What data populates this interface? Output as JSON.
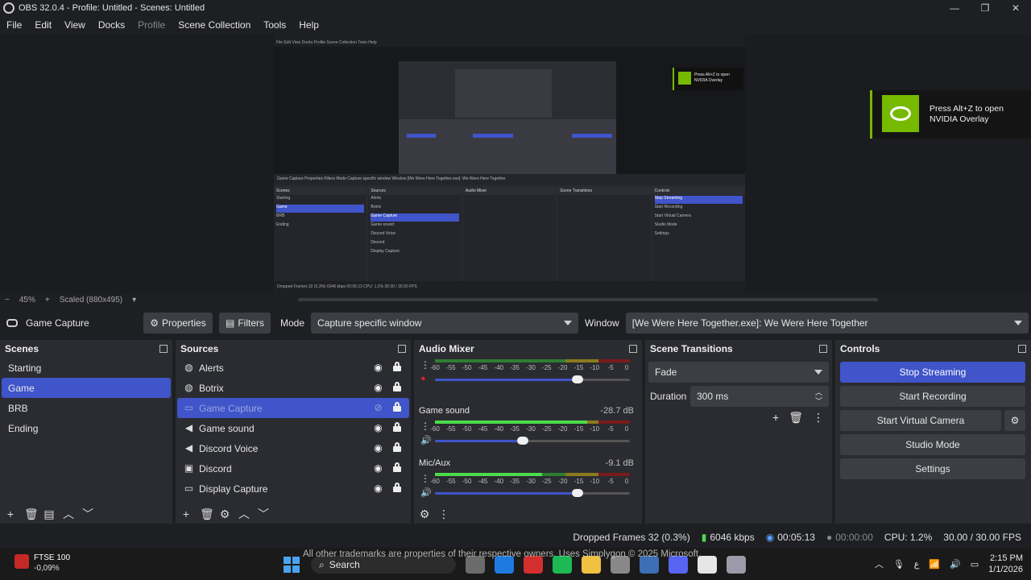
{
  "window": {
    "title": "OBS 32.0.4 - Profile: Untitled - Scenes: Untitled",
    "minimize": "—",
    "maximize": "❐",
    "close": "✕"
  },
  "menu": [
    "File",
    "Edit",
    "View",
    "Docks",
    "Profile",
    "Scene Collection",
    "Tools",
    "Help"
  ],
  "menu_disabled_index": 4,
  "nested_preview": {
    "menu_text": "File  Edit  View  Docks  Profile  Scene Collection  Tools  Help",
    "toolbar_text": "Game Capture    Properties    Filters    Mode   Capture specific window                         Window  [We Were Here Together.exe]: We Were Here Together",
    "scenes": [
      "Scenes",
      "Starting",
      "Game",
      "BRB",
      "Ending"
    ],
    "sources": [
      "Sources",
      "Alerts",
      "Botrix",
      "Game Capture",
      "Game sound",
      "Discord Voice",
      "Discord",
      "Display Capture"
    ],
    "mixer": "Audio Mixer",
    "transitions": "Scene Transitions",
    "controls": [
      "Controls",
      "Stop Streaming",
      "Start Recording",
      "Start Virtual Camera",
      "Studio Mode",
      "Settings"
    ],
    "toast": "Press Alt+Z to open NVIDIA Overlay",
    "status": "Dropped Frames 32 (0.3%)   6046 kbps   00:05:13   CPU: 1.2%   30.00 / 30.00 FPS"
  },
  "nvidia_toast": {
    "text": "Press Alt+Z to open NVIDIA Overlay",
    "accent": "#76b900"
  },
  "zoom": {
    "minus": "−",
    "percent": "45%",
    "plus": "+",
    "scaled": "Scaled (880x495)"
  },
  "context_bar": {
    "source_name": "Game Capture",
    "properties": "Properties",
    "filters": "Filters",
    "mode_label": "Mode",
    "mode_value": "Capture specific window",
    "window_label": "Window",
    "window_value": "[We Were Here Together.exe]: We Were Here Together"
  },
  "scenes": {
    "title": "Scenes",
    "items": [
      "Starting",
      "Game",
      "BRB",
      "Ending"
    ],
    "selected": 1
  },
  "sources": {
    "title": "Sources",
    "items": [
      {
        "name": "Alerts",
        "icon": "globe-icon"
      },
      {
        "name": "Botrix",
        "icon": "globe-icon"
      },
      {
        "name": "Game Capture",
        "icon": "gamepad-icon",
        "hidden": true
      },
      {
        "name": "Game sound",
        "icon": "speaker-icon"
      },
      {
        "name": "Discord Voice",
        "icon": "speaker-icon"
      },
      {
        "name": "Discord",
        "icon": "window-icon"
      },
      {
        "name": "Display Capture",
        "icon": "monitor-icon"
      }
    ],
    "selected": 2
  },
  "audio_mixer": {
    "title": "Audio Mixer",
    "ticks": [
      "-60",
      "-55",
      "-50",
      "-45",
      "-40",
      "-35",
      "-30",
      "-25",
      "-20",
      "-15",
      "-10",
      "-5",
      "0"
    ],
    "channels": [
      {
        "name": "",
        "db": "",
        "level": 0.0,
        "volume": 0.73
      },
      {
        "name": "Game sound",
        "db": "-28.7 dB",
        "level": 0.78,
        "volume": 0.45
      },
      {
        "name": "Mic/Aux",
        "db": "-9.1 dB",
        "level": 0.55,
        "volume": 0.73
      }
    ]
  },
  "scene_transitions": {
    "title": "Scene Transitions",
    "transition": "Fade",
    "duration_label": "Duration",
    "duration_value": "300 ms"
  },
  "controls": {
    "title": "Controls",
    "buttons": [
      "Stop Streaming",
      "Start Recording",
      "Start Virtual Camera",
      "Studio Mode",
      "Settings"
    ],
    "active_index": 0,
    "accent": "#3f55c9"
  },
  "status": {
    "dropped": "Dropped Frames 32 (0.3%)",
    "bitrate": "6046 kbps",
    "stream_time": "00:05:13",
    "rec_time": "00:00:00",
    "cpu": "CPU: 1.2%",
    "fps": "30.00 / 30.00 FPS"
  },
  "taskbar": {
    "stock_name": "FTSE 100",
    "stock_change": "-0,09%",
    "trademark": "All other trademarks are properties of their respective owners. Uses Simplygon © 2025 Microsoft.",
    "search": "Search",
    "time": "2:15 PM",
    "date": "1/1/2026",
    "lang": "ع",
    "app_colors": [
      "#6b6b6b",
      "#1f7ae0",
      "#d32f2f",
      "#1db954",
      "#f0c040",
      "#888888",
      "#3c6fb3",
      "#5865f2",
      "#e6e6e6",
      "#9a9aa8"
    ]
  }
}
